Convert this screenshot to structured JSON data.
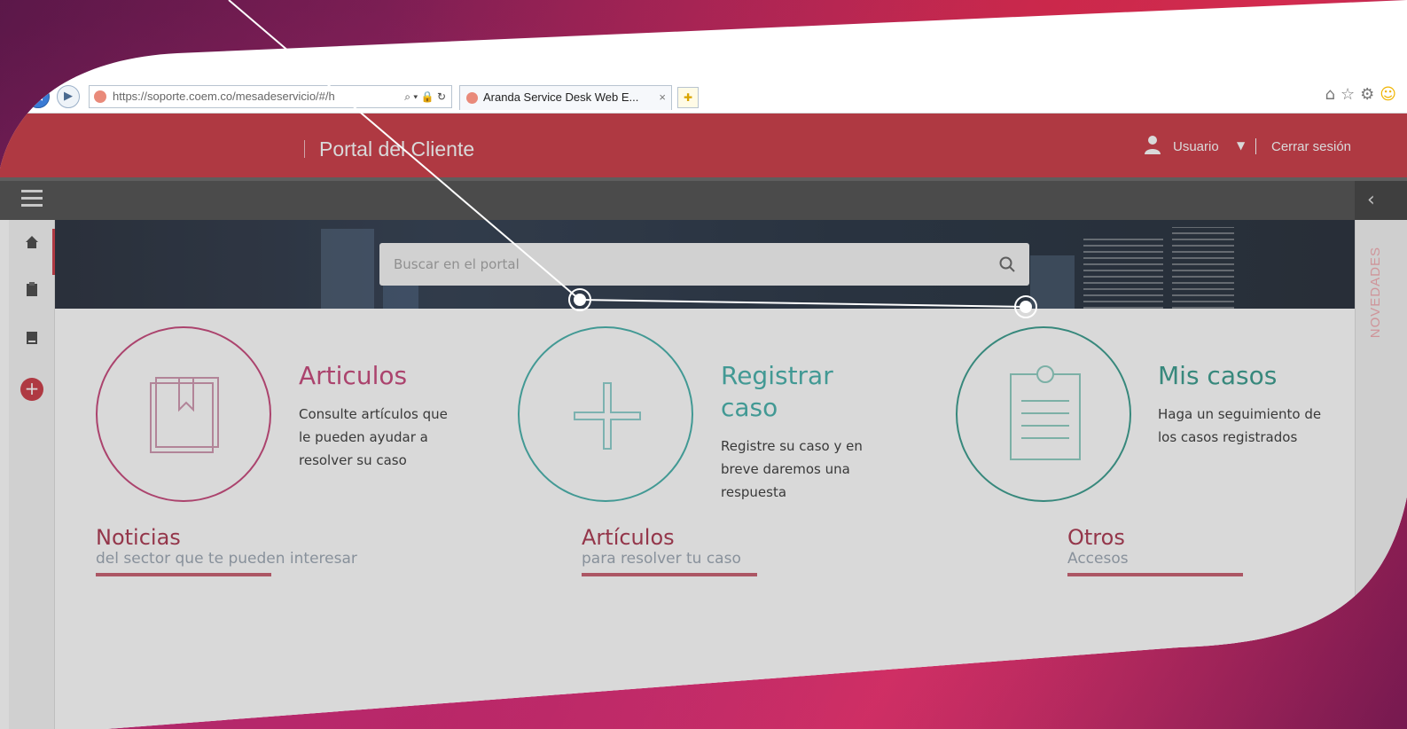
{
  "browser": {
    "url": "https://soporte.coem.co/mesadeservicio/#/h",
    "tab_title": "Aranda Service Desk Web E...",
    "tab_close": "×",
    "address_tools": "⌕ ▾ 🔒 ↻"
  },
  "header": {
    "title": "Portal del Cliente",
    "user_label": "Usuario",
    "logout_label": "Cerrar sesión"
  },
  "search": {
    "placeholder": "Buscar en el portal"
  },
  "rail": {
    "label": "NOVEDADES"
  },
  "cards": [
    {
      "title": "Articulos",
      "description": "Consulte artículos que le pueden ayudar a resolver su caso",
      "color": "#c0306a",
      "icon": "book-icon"
    },
    {
      "title": "Registrar caso",
      "description": "Registre su caso y en breve daremos una respuesta",
      "color": "#2fa7a0",
      "icon": "plus-icon"
    },
    {
      "title": "Mis casos",
      "description": "Haga un seguimiento de los casos registrados",
      "color": "#1f8f7e",
      "icon": "clipboard-icon"
    }
  ],
  "sections": [
    {
      "title": "Noticias",
      "subtitle": "del sector que te pueden interesar"
    },
    {
      "title": "Artículos",
      "subtitle": "para resolver tu caso"
    },
    {
      "title": "Otros",
      "subtitle": "Accesos"
    }
  ],
  "colors": {
    "header_red": "#c5222f",
    "toolbar": "#3b3b3b",
    "pink": "#c0306a",
    "teal": "#2fa7a0",
    "green_teal": "#1f8f7e"
  }
}
